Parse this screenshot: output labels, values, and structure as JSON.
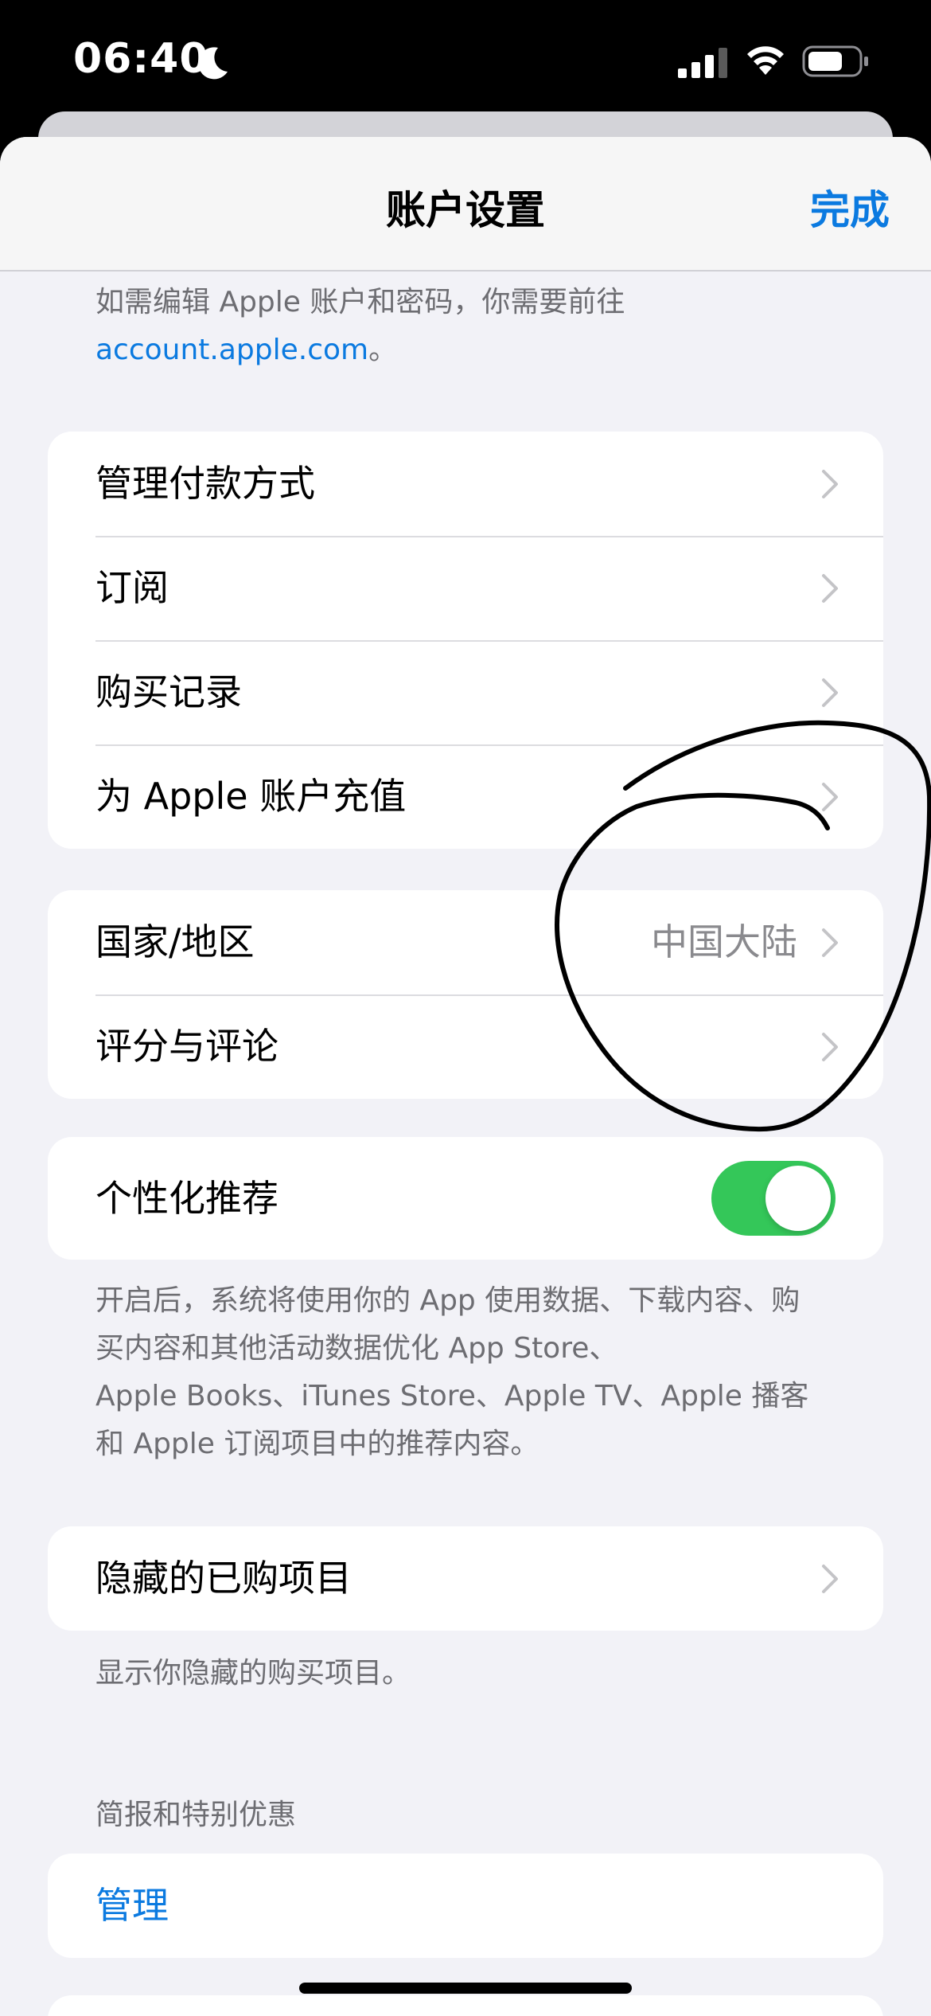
{
  "status_bar": {
    "time": "06:40",
    "icons": [
      "moon-icon",
      "signal-icon",
      "wifi-icon",
      "battery-icon"
    ]
  },
  "nav": {
    "title": "账户设置",
    "done_label": "完成"
  },
  "intro": {
    "text": "如需编辑 Apple 账户和密码，你需要前往",
    "link": "account.apple.com",
    "suffix": "。"
  },
  "group_payment": {
    "items": [
      {
        "label": "管理付款方式"
      },
      {
        "label": "订阅"
      },
      {
        "label": "购买记录"
      },
      {
        "label": "为 Apple 账户充值"
      }
    ]
  },
  "group_region": {
    "items": [
      {
        "label": "国家/地区",
        "value": "中国大陆"
      },
      {
        "label": "评分与评论"
      }
    ]
  },
  "personalized": {
    "label": "个性化推荐",
    "enabled": true,
    "footer_line1": "开启后，系统将使用你的 App 使用数据、下载内容、购",
    "footer_line2": "买内容和其他活动数据优化 App Store、",
    "footer_line3": "Apple Books、iTunes Store、Apple TV、Apple 播客",
    "footer_line4": "和 Apple 订阅项目中的推荐内容。"
  },
  "hidden_purchases": {
    "label": "隐藏的已购项目",
    "footer": "显示你隐藏的购买项目。"
  },
  "newsletter": {
    "header": "简报和特别优惠",
    "manage_label": "管理"
  },
  "colors": {
    "accent": "#0b7ae0",
    "toggle_on": "#34c759",
    "background": "#f2f2f7",
    "annotation": "#000000"
  }
}
